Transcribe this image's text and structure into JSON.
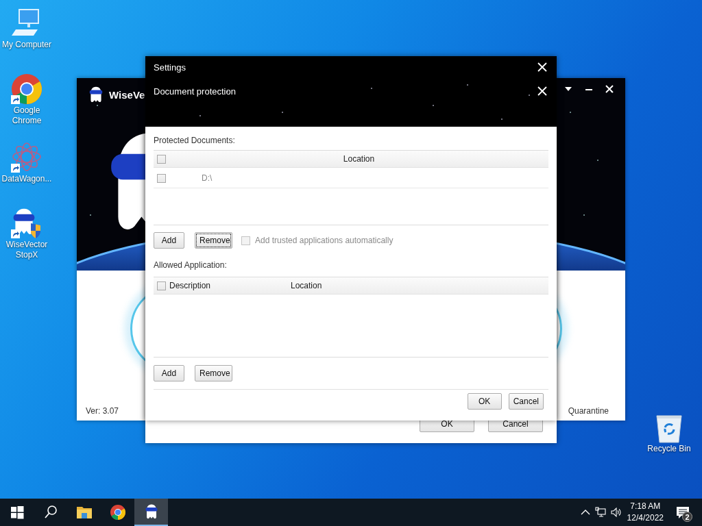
{
  "desktop_icons": [
    {
      "label": "My Computer",
      "kind": "computer",
      "shortcut": false
    },
    {
      "label": "Google Chrome",
      "kind": "chrome",
      "shortcut": true
    },
    {
      "label": "DataWagon...",
      "kind": "datawagon",
      "shortcut": true
    },
    {
      "label": "WiseVector StopX",
      "kind": "wisevector",
      "shortcut": true
    }
  ],
  "recycle_bin": {
    "label": "Recycle Bin"
  },
  "main_window": {
    "title": "WiseVe",
    "version": "Ver: 3.07",
    "footer_link": "Quarantine"
  },
  "settings_window": {
    "title": "Settings",
    "buttons": [
      "OK",
      "Cancel"
    ]
  },
  "dialog": {
    "title": "Document protection",
    "protected_documents": {
      "label": "Protected Documents:",
      "select_all_checked": false,
      "columns": [
        "Location"
      ],
      "rows": [
        {
          "location": "D:\\",
          "checked": false
        }
      ],
      "buttons": [
        {
          "label": "Add",
          "focused": false
        },
        {
          "label": "Remove",
          "focused": true
        }
      ],
      "auto_trust": {
        "label": "Add trusted applications automatically",
        "checked": false,
        "disabled": true
      }
    },
    "allowed_applications": {
      "label": "Allowed Application:",
      "select_all_checked": false,
      "columns": [
        "Description",
        "Location"
      ],
      "buttons": [
        {
          "label": "Add",
          "focused": false
        },
        {
          "label": "Remove",
          "focused": false
        }
      ]
    },
    "buttons": [
      "OK",
      "Cancel"
    ]
  },
  "taskbar": {
    "apps": [
      {
        "kind": "start",
        "selected": false
      },
      {
        "kind": "search",
        "selected": false
      },
      {
        "kind": "explorer",
        "selected": false
      },
      {
        "kind": "chrome",
        "selected": false
      },
      {
        "kind": "wisevector",
        "selected": true
      }
    ],
    "time": "7:18 AM",
    "date": "12/4/2022",
    "notification_count": "2"
  }
}
